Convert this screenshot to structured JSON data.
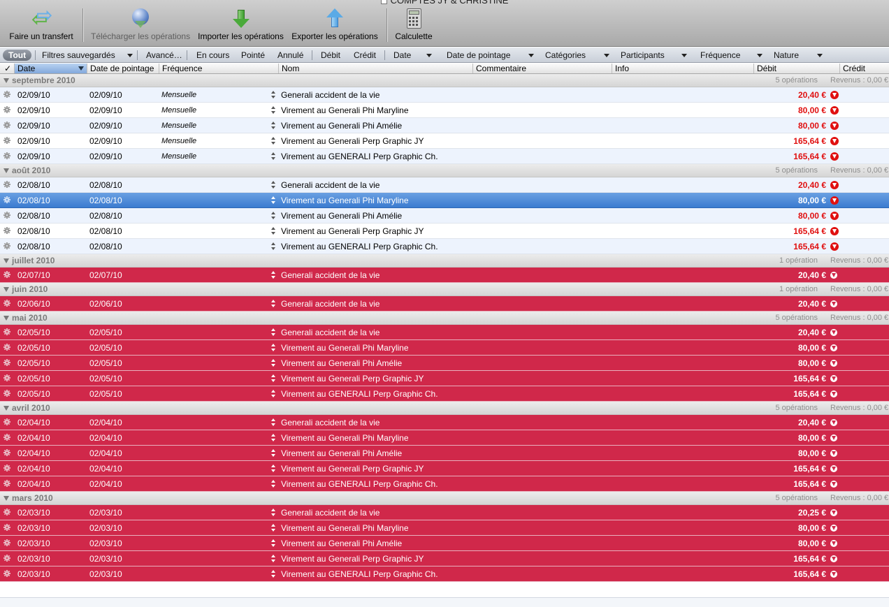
{
  "window": {
    "title": "COMPTES JY & CHRISTINE"
  },
  "toolbar": {
    "transfer": "Faire un transfert",
    "download": "Télécharger les opérations",
    "import": "Importer les opérations",
    "export": "Exporter les opérations",
    "calc": "Calculette"
  },
  "filters": {
    "tout": "Tout",
    "saved": "Filtres sauvegardés",
    "advanced": "Avancé…",
    "en_cours": "En cours",
    "pointe": "Pointé",
    "annule": "Annulé",
    "debit": "Débit",
    "credit": "Crédit",
    "date": "Date",
    "date_pointage": "Date de pointage",
    "categories": "Catégories",
    "participants": "Participants",
    "frequence": "Fréquence",
    "nature": "Nature"
  },
  "columns": {
    "check": "✓",
    "date": "Date",
    "date_pointage": "Date de pointage",
    "frequence": "Fréquence",
    "nom": "Nom",
    "commentaire": "Commentaire",
    "info": "Info",
    "debit": "Débit",
    "credit": "Crédit"
  },
  "colors": {
    "red_row": "#d0284a",
    "selection": "#3b7bd0",
    "debit_text": "#e01010"
  },
  "groups": [
    {
      "name": "septembre 2010",
      "count": "5 opérations",
      "revenue": "Revenus : 0,00 €",
      "style": "normal",
      "rows": [
        {
          "date": "02/09/10",
          "pointage": "02/09/10",
          "freq": "Mensuelle",
          "nom": "Generali accident de la vie",
          "debit": "20,40 €"
        },
        {
          "date": "02/09/10",
          "pointage": "02/09/10",
          "freq": "Mensuelle",
          "nom": "Virement au Generali Phi Maryline",
          "debit": "80,00 €"
        },
        {
          "date": "02/09/10",
          "pointage": "02/09/10",
          "freq": "Mensuelle",
          "nom": "Virement au Generali Phi Amélie",
          "debit": "80,00 €"
        },
        {
          "date": "02/09/10",
          "pointage": "02/09/10",
          "freq": "Mensuelle",
          "nom": "Virement au Generali Perp Graphic JY",
          "debit": "165,64 €"
        },
        {
          "date": "02/09/10",
          "pointage": "02/09/10",
          "freq": "Mensuelle",
          "nom": "Virement au GENERALI Perp Graphic Ch.",
          "debit": "165,64 €"
        }
      ]
    },
    {
      "name": "août 2010",
      "count": "5 opérations",
      "revenue": "Revenus : 0,00 €",
      "style": "normal",
      "rows": [
        {
          "date": "02/08/10",
          "pointage": "02/08/10",
          "freq": "",
          "nom": "Generali accident de la vie",
          "debit": "20,40 €"
        },
        {
          "date": "02/08/10",
          "pointage": "02/08/10",
          "freq": "",
          "nom": "Virement au Generali Phi Maryline",
          "debit": "80,00 €",
          "selected": true
        },
        {
          "date": "02/08/10",
          "pointage": "02/08/10",
          "freq": "",
          "nom": "Virement au Generali Phi Amélie",
          "debit": "80,00 €"
        },
        {
          "date": "02/08/10",
          "pointage": "02/08/10",
          "freq": "",
          "nom": "Virement au Generali Perp Graphic JY",
          "debit": "165,64 €"
        },
        {
          "date": "02/08/10",
          "pointage": "02/08/10",
          "freq": "",
          "nom": "Virement au GENERALI Perp Graphic Ch.",
          "debit": "165,64 €"
        }
      ]
    },
    {
      "name": "juillet 2010",
      "count": "1 opération",
      "revenue": "Revenus : 0,00 €",
      "style": "red",
      "rows": [
        {
          "date": "02/07/10",
          "pointage": "02/07/10",
          "freq": "",
          "nom": "Generali accident de la vie",
          "debit": "20,40 €"
        }
      ]
    },
    {
      "name": "juin 2010",
      "count": "1 opération",
      "revenue": "Revenus : 0,00 €",
      "style": "red",
      "rows": [
        {
          "date": "02/06/10",
          "pointage": "02/06/10",
          "freq": "",
          "nom": "Generali accident de la vie",
          "debit": "20,40 €"
        }
      ]
    },
    {
      "name": "mai 2010",
      "count": "5 opérations",
      "revenue": "Revenus : 0,00 €",
      "style": "red",
      "rows": [
        {
          "date": "02/05/10",
          "pointage": "02/05/10",
          "freq": "",
          "nom": "Generali accident de la vie",
          "debit": "20,40 €"
        },
        {
          "date": "02/05/10",
          "pointage": "02/05/10",
          "freq": "",
          "nom": "Virement au Generali Phi Maryline",
          "debit": "80,00 €"
        },
        {
          "date": "02/05/10",
          "pointage": "02/05/10",
          "freq": "",
          "nom": "Virement au Generali Phi Amélie",
          "debit": "80,00 €"
        },
        {
          "date": "02/05/10",
          "pointage": "02/05/10",
          "freq": "",
          "nom": "Virement au Generali Perp Graphic JY",
          "debit": "165,64 €"
        },
        {
          "date": "02/05/10",
          "pointage": "02/05/10",
          "freq": "",
          "nom": "Virement au GENERALI Perp Graphic Ch.",
          "debit": "165,64 €"
        }
      ]
    },
    {
      "name": "avril 2010",
      "count": "5 opérations",
      "revenue": "Revenus : 0,00 €",
      "style": "red",
      "rows": [
        {
          "date": "02/04/10",
          "pointage": "02/04/10",
          "freq": "",
          "nom": "Generali accident de la vie",
          "debit": "20,40 €"
        },
        {
          "date": "02/04/10",
          "pointage": "02/04/10",
          "freq": "",
          "nom": "Virement au Generali Phi Maryline",
          "debit": "80,00 €"
        },
        {
          "date": "02/04/10",
          "pointage": "02/04/10",
          "freq": "",
          "nom": "Virement au Generali Phi Amélie",
          "debit": "80,00 €"
        },
        {
          "date": "02/04/10",
          "pointage": "02/04/10",
          "freq": "",
          "nom": "Virement au Generali Perp Graphic JY",
          "debit": "165,64 €"
        },
        {
          "date": "02/04/10",
          "pointage": "02/04/10",
          "freq": "",
          "nom": "Virement au GENERALI Perp Graphic Ch.",
          "debit": "165,64 €"
        }
      ]
    },
    {
      "name": "mars 2010",
      "count": "5 opérations",
      "revenue": "Revenus : 0,00 €",
      "style": "red",
      "rows": [
        {
          "date": "02/03/10",
          "pointage": "02/03/10",
          "freq": "",
          "nom": "Generali accident de la vie",
          "debit": "20,25 €"
        },
        {
          "date": "02/03/10",
          "pointage": "02/03/10",
          "freq": "",
          "nom": "Virement au Generali Phi Maryline",
          "debit": "80,00 €"
        },
        {
          "date": "02/03/10",
          "pointage": "02/03/10",
          "freq": "",
          "nom": "Virement au Generali Phi Amélie",
          "debit": "80,00 €"
        },
        {
          "date": "02/03/10",
          "pointage": "02/03/10",
          "freq": "",
          "nom": "Virement au Generali Perp Graphic JY",
          "debit": "165,64 €"
        },
        {
          "date": "02/03/10",
          "pointage": "02/03/10",
          "freq": "",
          "nom": "Virement au GENERALI Perp Graphic Ch.",
          "debit": "165,64 €"
        }
      ]
    }
  ]
}
